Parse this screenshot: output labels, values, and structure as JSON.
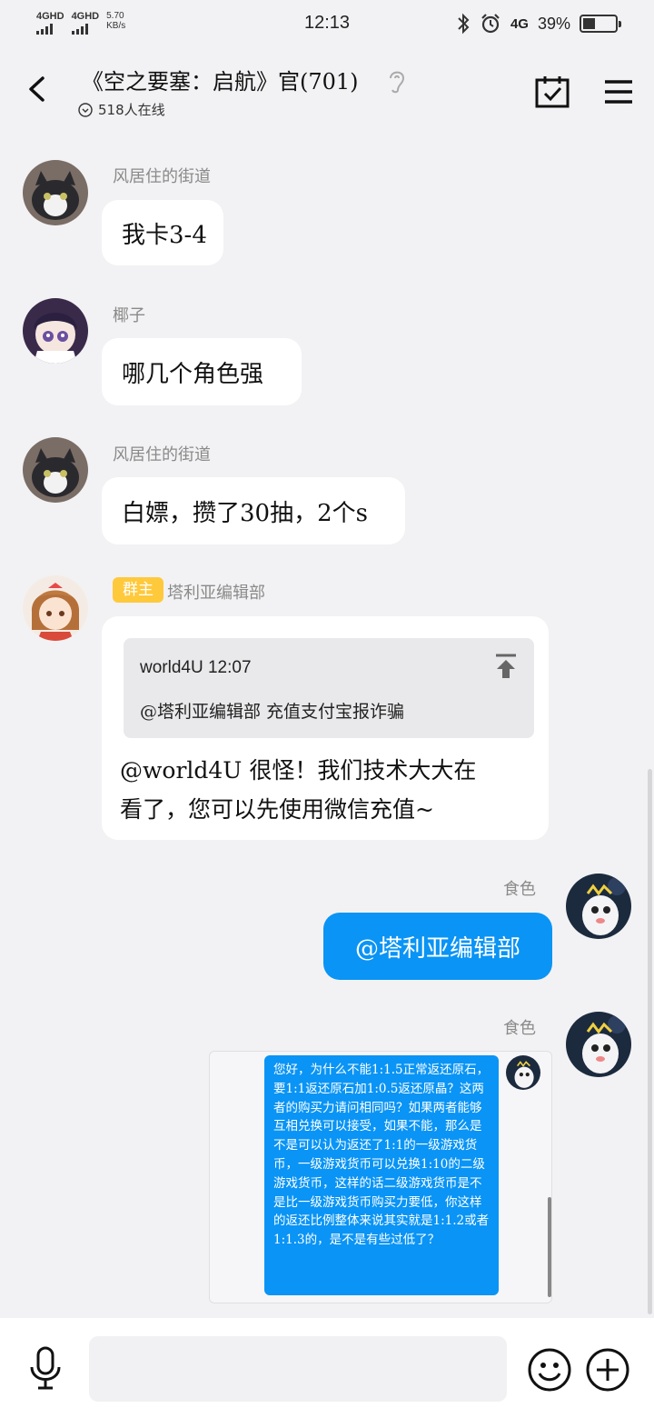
{
  "status_bar": {
    "sim1": "4GHD",
    "sim2": "4GHD",
    "speed_value": "5.70",
    "speed_unit": "KB/s",
    "time": "12:13",
    "network": "4G",
    "battery": "39%",
    "battery_level": 0.39
  },
  "header": {
    "title": "《空之要塞：启航》官(701)",
    "online": "518人在线",
    "icons": [
      "back-icon",
      "ear-icon",
      "calendar-check-icon",
      "menu-icon"
    ]
  },
  "messages": [
    {
      "sender": "风居住的街道",
      "text": "我卡3-4"
    },
    {
      "sender": "椰子",
      "text": "哪几个角色强"
    },
    {
      "sender": "风居住的街道",
      "text": "白嫖，攒了30抽，2个s"
    },
    {
      "badge": "群主",
      "sender": "塔利亚编辑部",
      "quote_header": "world4U 12:07",
      "quote_text": "@塔利亚编辑部 充值支付宝报诈骗",
      "text_line1": "@world4U 很怪！我们技术大大在",
      "text_line2": "看了，您可以先使用微信充值~"
    },
    {
      "sender": "食色",
      "text": "@塔利亚编辑部",
      "outgoing": true
    },
    {
      "sender": "食色",
      "outgoing": true,
      "image_text": "您好，为什么不能1:1.5正常返还原石，要1:1返还原石加1:0.5返还原晶？这两者的购买力请问相同吗？如果两者能够互相兑换可以接受，如果不能，那么是不是可以认为返还了1:1的一级游戏货币，一级游戏货币可以兑换1:10的二级游戏货币，这样的话二级游戏货币是不是比一级游戏货币购买力要低，你这样的返还比例整体来说其实就是1:1.2或者1:1.3的，是不是有些过低了？"
    }
  ],
  "input": {
    "placeholder": "",
    "icons": [
      "microphone-icon",
      "emoji-icon",
      "plus-icon"
    ]
  },
  "colors": {
    "background": "#f2f2f4",
    "outgoing_bubble": "#0a94f5",
    "owner_badge": "#ffc93c"
  }
}
